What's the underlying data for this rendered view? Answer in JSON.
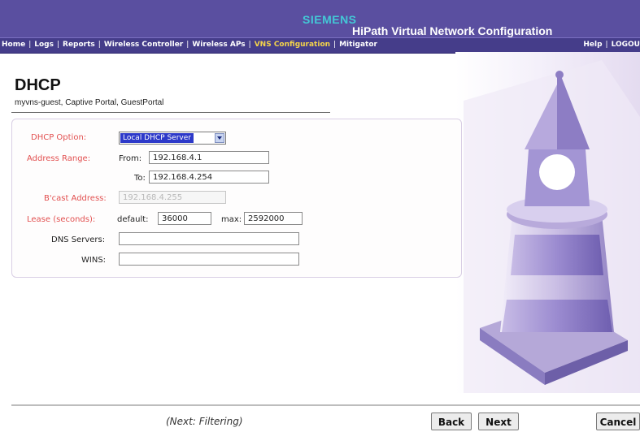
{
  "header": {
    "brand": "SIEMENS",
    "app_title": "HiPath Virtual Network Configuration"
  },
  "nav": {
    "items": [
      "Home",
      "Logs",
      "Reports",
      "Wireless Controller",
      "Wireless APs",
      "VNS Configuration",
      "Mitigator"
    ],
    "active": "VNS Configuration",
    "right_items": [
      "Help",
      "LOGOU"
    ]
  },
  "page": {
    "title": "DHCP",
    "subtitle": "myvns-guest, Captive Portal, GuestPortal"
  },
  "form": {
    "dhcp_option_label": "DHCP Option:",
    "dhcp_option_value": "Local DHCP Server",
    "address_range_label": "Address Range:",
    "from_label": "From:",
    "from_value": "192.168.4.1",
    "to_label": "To:",
    "to_value": "192.168.4.254",
    "bcast_label": "B'cast Address:",
    "bcast_value": "192.168.4.255",
    "lease_label": "Lease (seconds):",
    "default_label": "default:",
    "default_value": "36000",
    "max_label": "max:",
    "max_value": "2592000",
    "dns_label": "DNS Servers:",
    "dns_value": "",
    "wins_label": "WINS:",
    "wins_value": ""
  },
  "footer": {
    "next_hint": "(Next: Filtering)",
    "back_label": "Back",
    "next_label": "Next",
    "cancel_label": "Cancel"
  },
  "colors": {
    "header_bg": "#5a4fa0",
    "nav_bg": "#453d8a",
    "brand": "#43c8d6",
    "active_nav": "#f4d44a",
    "required_label": "#e25050",
    "selection": "#2d39c9"
  }
}
